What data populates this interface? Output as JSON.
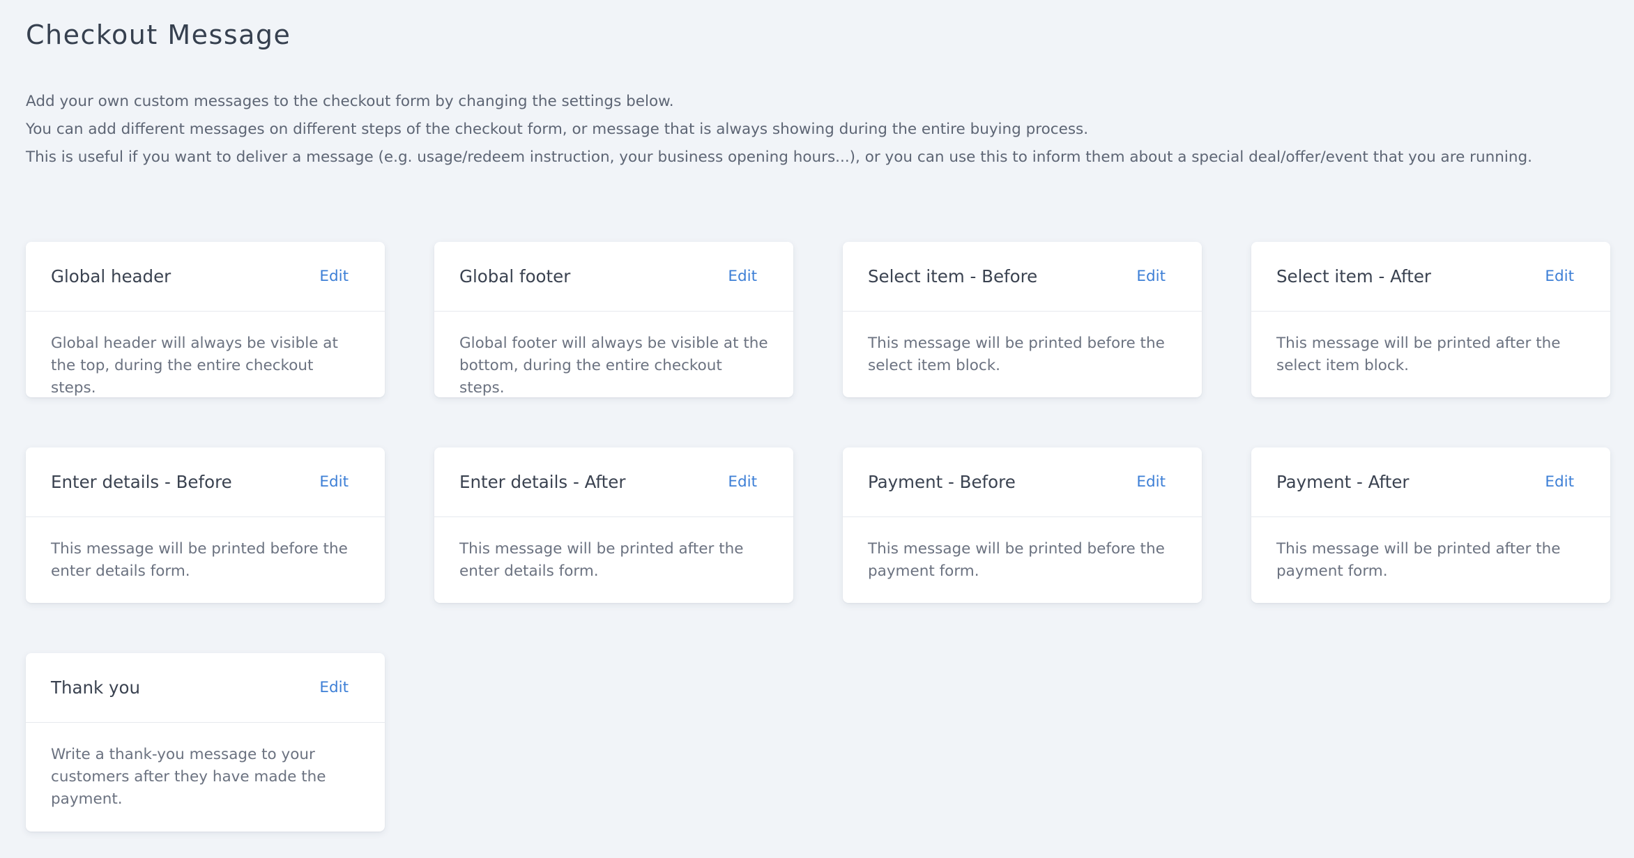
{
  "page": {
    "title": "Checkout Message",
    "intro": [
      "Add your own custom messages to the checkout form by changing the settings below.",
      "You can add different messages on different steps of the checkout form, or message that is always showing during the entire buying process.",
      "This is useful if you want to deliver a message (e.g. usage/redeem instruction, your business opening hours...), or you can use this to inform them about a special deal/offer/event that you are running."
    ]
  },
  "colors": {
    "background": "#f1f4f8",
    "card": "#ffffff",
    "link": "#3d7fd6",
    "heading": "#36404f",
    "body_text": "#6b7280"
  },
  "cards": [
    {
      "title": "Global header",
      "edit_label": "Edit",
      "description": "Global header will always be visible at the top, during the entire checkout steps."
    },
    {
      "title": "Global footer",
      "edit_label": "Edit",
      "description": "Global footer will always be visible at the bottom, during the entire checkout steps."
    },
    {
      "title": "Select item - Before",
      "edit_label": "Edit",
      "description": "This message will be printed before the select item block."
    },
    {
      "title": "Select item - After",
      "edit_label": "Edit",
      "description": "This message will be printed after the select item block."
    },
    {
      "title": "Enter details - Before",
      "edit_label": "Edit",
      "description": "This message will be printed before the enter details form."
    },
    {
      "title": "Enter details - After",
      "edit_label": "Edit",
      "description": "This message will be printed after the enter details form."
    },
    {
      "title": "Payment - Before",
      "edit_label": "Edit",
      "description": "This message will be printed before the payment form."
    },
    {
      "title": "Payment - After",
      "edit_label": "Edit",
      "description": "This message will be printed after the payment form."
    },
    {
      "title": "Thank you",
      "edit_label": "Edit",
      "description": "Write a thank-you message to your customers after they have made the payment."
    }
  ]
}
